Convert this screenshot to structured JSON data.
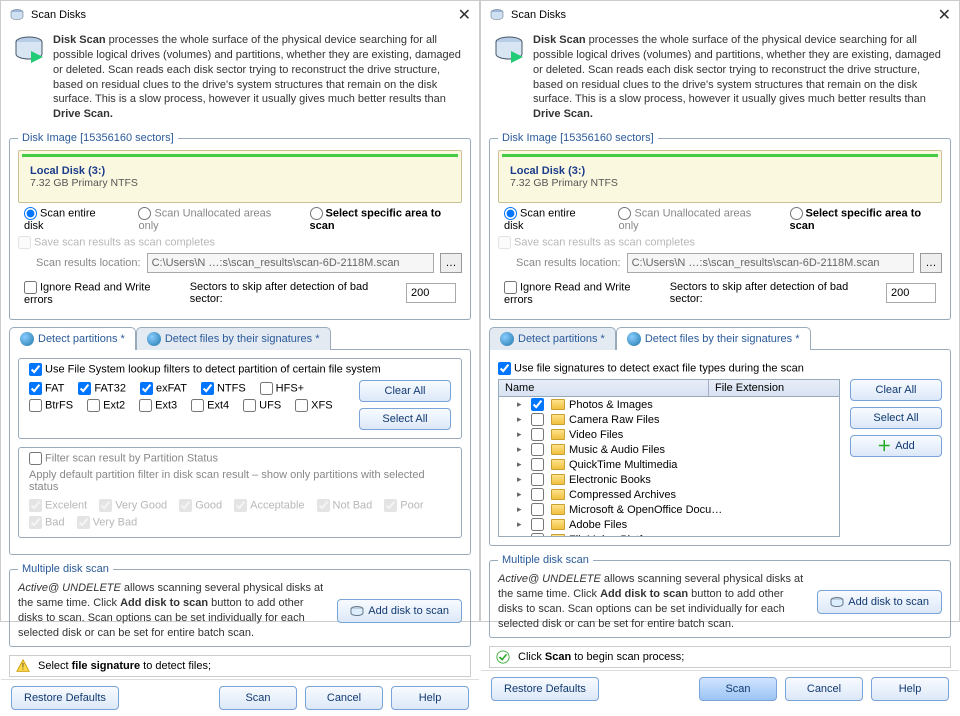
{
  "title": "Scan Disks",
  "intro_bold": "Disk Scan",
  "intro_text": " processes the whole surface of the physical device  searching for all possible logical drives (volumes) and partitions, whether they are existing, damaged or deleted. Scan reads each disk sector trying to reconstruct the drive structure, based on residual clues to the drive's system structures that remain on the disk surface. This is a slow process, however it usually gives much better results than ",
  "intro_tail_bold": "Drive Scan.",
  "group_disk": "Disk Image [15356160 sectors]",
  "disk_title": "Local Disk (3:)",
  "disk_sub": "7.32 GB Primary NTFS",
  "radios": {
    "entire": "Scan entire disk",
    "unalloc": "Scan Unallocated areas only",
    "specific": "Select specific area to scan"
  },
  "save_results": "Save scan results as scan completes",
  "results_loc_label": "Scan results location:",
  "results_path": "C:\\Users\\N …:s\\scan_results\\scan-6D-2118M.scan",
  "ignore_errors": "Ignore Read and Write errors",
  "sectors_skip_label": "Sectors to skip after detection of bad sector:",
  "sectors_skip_value": "200",
  "tabs": {
    "partitions": "Detect partitions *",
    "files_left": "Detect files by their signatures *",
    "files_right": "Detect files by their signatures *"
  },
  "left": {
    "use_filters": "Use File System lookup filters to detect partition of certain file system",
    "fs": [
      "FAT",
      "FAT32",
      "exFAT",
      "NTFS",
      "HFS+",
      "BtrFS",
      "Ext2",
      "Ext3",
      "Ext4",
      "UFS",
      "XFS"
    ],
    "fs_checked": [
      true,
      true,
      true,
      true,
      false,
      false,
      false,
      false,
      false,
      false,
      false
    ],
    "btn_clear": "Clear All",
    "btn_select": "Select All",
    "filter_status_title": "Filter scan result by Partition Status",
    "filter_status_desc": "Apply default partition filter in disk scan result – show only partitions with selected status",
    "statuses": [
      "Excelent",
      "Very Good",
      "Good",
      "Acceptable",
      "Not Bad",
      "Poor",
      "Bad",
      "Very Bad"
    ]
  },
  "right": {
    "use_sigs": "Use file signatures to detect  exact file types during the scan",
    "col_name": "Name",
    "col_ext": "File Extension",
    "items": [
      "Photos & Images",
      "Camera Raw Files",
      "Video Files",
      "Music & Audio Files",
      "QuickTime Multimedia",
      "Electronic Books",
      "Compressed Archives",
      "Microsoft & OpenOffice Docu…",
      "Adobe Files",
      "FileMaker Platform"
    ],
    "item_checked": [
      true,
      false,
      false,
      false,
      false,
      false,
      false,
      false,
      false,
      false
    ],
    "btn_clear": "Clear All",
    "btn_select": "Select All",
    "btn_add": "Add"
  },
  "multi": {
    "legend": "Multiple disk scan",
    "text_pre": "Active@ UNDELETE",
    "text_body": " allows scanning several physical disks at the same time. Click ",
    "text_bold2": "Add disk to scan",
    "text_tail": " button to add other disks to scan. Scan options can be set individually for each selected disk or can be set for entire batch scan.",
    "btn": "Add disk to scan"
  },
  "hint_left_pre": "Select ",
  "hint_left_bold": "file signature",
  "hint_left_post": " to detect files;",
  "hint_right_pre": "Click ",
  "hint_right_bold": "Scan",
  "hint_right_post": " to begin scan process;",
  "bottom": {
    "restore": "Restore Defaults",
    "scan": "Scan",
    "cancel": "Cancel",
    "help": "Help"
  }
}
